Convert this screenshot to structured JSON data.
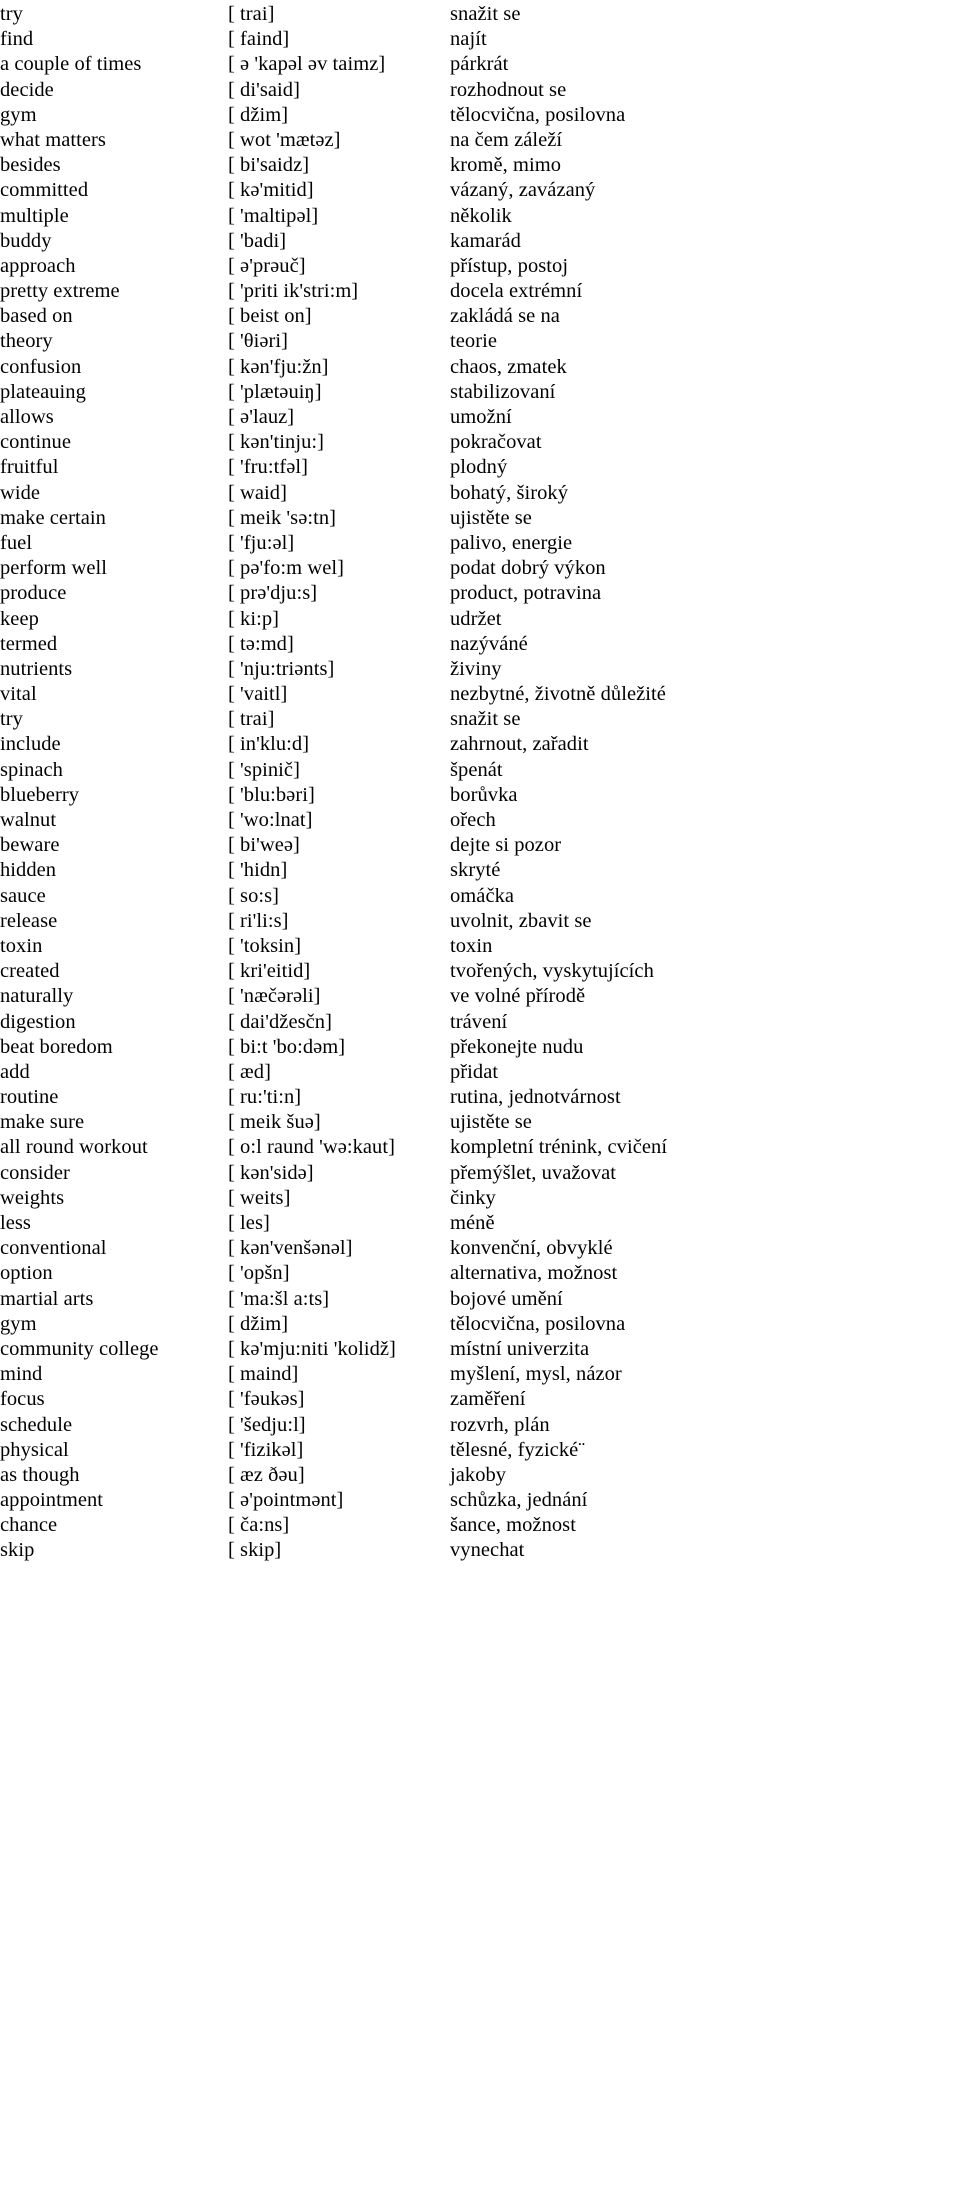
{
  "document": {
    "type": "vocabulary-list",
    "columns": [
      "english",
      "phonetic",
      "czech"
    ],
    "background_color": "#ffffff",
    "text_color": "#000000"
  },
  "rows": [
    {
      "english": "try",
      "phonetic": "[ trai]",
      "czech": "snažit se"
    },
    {
      "english": "find",
      "phonetic": "[ faind]",
      "czech": "najít"
    },
    {
      "english": "a couple of times",
      "phonetic": "[ ə 'kapəl əv taimz]",
      "czech": "párkrát"
    },
    {
      "english": "decide",
      "phonetic": "[ di'said]",
      "czech": "rozhodnout se"
    },
    {
      "english": "gym",
      "phonetic": "[ džim]",
      "czech": "tělocvična, posilovna"
    },
    {
      "english": "what matters",
      "phonetic": "[ wot 'mætəz]",
      "czech": "na čem záleží"
    },
    {
      "english": "besides",
      "phonetic": "[ bi'saidz]",
      "czech": "kromě, mimo"
    },
    {
      "english": "committed",
      "phonetic": "[ kə'mitid]",
      "czech": "vázaný, zavázaný"
    },
    {
      "english": "multiple",
      "phonetic": "[ 'maltipəl]",
      "czech": "několik"
    },
    {
      "english": "buddy",
      "phonetic": "[ 'badi]",
      "czech": "kamarád"
    },
    {
      "english": "approach",
      "phonetic": "[ ə'prəuč]",
      "czech": "přístup, postoj"
    },
    {
      "english": "pretty extreme",
      "phonetic": "[ 'priti ik'stri:m]",
      "czech": "docela extrémní"
    },
    {
      "english": "based on",
      "phonetic": "[ beist on]",
      "czech": "zakládá se na"
    },
    {
      "english": "theory",
      "phonetic": "[ 'θiəri]",
      "czech": "teorie"
    },
    {
      "english": "confusion",
      "phonetic": "[ kən'fju:žn]",
      "czech": "chaos, zmatek"
    },
    {
      "english": "plateauing",
      "phonetic": "[ 'plætəuiŋ]",
      "czech": "stabilizovaní"
    },
    {
      "english": "allows",
      "phonetic": "[ ə'lauz]",
      "czech": "umožní"
    },
    {
      "english": "continue",
      "phonetic": "[ kən'tinju:]",
      "czech": "pokračovat"
    },
    {
      "english": "fruitful",
      "phonetic": "[ 'fru:tfəl]",
      "czech": "plodný"
    },
    {
      "english": "wide",
      "phonetic": "[ waid]",
      "czech": "bohatý, široký"
    },
    {
      "english": "make certain",
      "phonetic": "[ meik 'sə:tn]",
      "czech": "ujistěte se"
    },
    {
      "english": "fuel",
      "phonetic": "[ 'fju:əl]",
      "czech": "palivo, energie"
    },
    {
      "english": "perform well",
      "phonetic": "[ pə'fo:m wel]",
      "czech": "podat dobrý výkon"
    },
    {
      "english": "produce",
      "phonetic": "[ prə'dju:s]",
      "czech": "product, potravina"
    },
    {
      "english": "keep",
      "phonetic": "[ ki:p]",
      "czech": "udržet"
    },
    {
      "english": "termed",
      "phonetic": "[ tə:md]",
      "czech": "nazýváné"
    },
    {
      "english": "nutrients",
      "phonetic": "[ 'nju:triənts]",
      "czech": "živiny"
    },
    {
      "english": "vital",
      "phonetic": "[ 'vaitl]",
      "czech": "nezbytné, životně důležité"
    },
    {
      "english": "try",
      "phonetic": "[ trai]",
      "czech": "snažit se"
    },
    {
      "english": "include",
      "phonetic": "[ in'klu:d]",
      "czech": "zahrnout, zařadit"
    },
    {
      "english": "spinach",
      "phonetic": "[ 'spinič]",
      "czech": "špenát"
    },
    {
      "english": "blueberry",
      "phonetic": "[ 'blu:bəri]",
      "czech": "borůvka"
    },
    {
      "english": "walnut",
      "phonetic": "[ 'wo:lnat]",
      "czech": "ořech"
    },
    {
      "english": "beware",
      "phonetic": "[ bi'weə]",
      "czech": "dejte si pozor"
    },
    {
      "english": "hidden",
      "phonetic": "[ 'hidn]",
      "czech": "skryté"
    },
    {
      "english": "sauce",
      "phonetic": "[ so:s]",
      "czech": "omáčka"
    },
    {
      "english": "release",
      "phonetic": "[ ri'li:s]",
      "czech": "uvolnit, zbavit se"
    },
    {
      "english": "toxin",
      "phonetic": "[ 'toksin]",
      "czech": "toxin"
    },
    {
      "english": "created",
      "phonetic": "[ kri'eitid]",
      "czech": "tvořených, vyskytujících"
    },
    {
      "english": "naturally",
      "phonetic": "[ 'næčərəli]",
      "czech": "ve volné přírodě"
    },
    {
      "english": "digestion",
      "phonetic": "[ dai'džesčn]",
      "czech": "trávení"
    },
    {
      "english": "beat boredom",
      "phonetic": "[ bi:t 'bo:dəm]",
      "czech": "překonejte nudu"
    },
    {
      "english": "add",
      "phonetic": "[ æd]",
      "czech": "přidat"
    },
    {
      "english": "routine",
      "phonetic": "[ ru:'ti:n]",
      "czech": "rutina, jednotvárnost"
    },
    {
      "english": "make sure",
      "phonetic": "[ meik šuə]",
      "czech": "ujistěte se"
    },
    {
      "english": "all round workout",
      "phonetic": "[ o:l raund 'wə:kaut]",
      "czech": "kompletní trénink, cvičení"
    },
    {
      "english": "consider",
      "phonetic": "[ kən'sidə]",
      "czech": "přemýšlet, uvažovat"
    },
    {
      "english": "weights",
      "phonetic": "[ weits]",
      "czech": "činky"
    },
    {
      "english": "less",
      "phonetic": "[ les]",
      "czech": "méně"
    },
    {
      "english": "conventional",
      "phonetic": "[ kən'venšənəl]",
      "czech": "konvenční, obvyklé"
    },
    {
      "english": "option",
      "phonetic": "[ 'opšn]",
      "czech": "alternativa, možnost"
    },
    {
      "english": "martial arts",
      "phonetic": "[ 'ma:šl a:ts]",
      "czech": "bojové umění"
    },
    {
      "english": "gym",
      "phonetic": "[ džim]",
      "czech": "tělocvična, posilovna"
    },
    {
      "english": "community college",
      "phonetic": "[ kə'mju:niti 'kolidž]",
      "czech": "místní univerzita"
    },
    {
      "english": "mind",
      "phonetic": "[ maind]",
      "czech": "myšlení, mysl, názor"
    },
    {
      "english": "focus",
      "phonetic": "[ 'fəukəs]",
      "czech": "zaměření"
    },
    {
      "english": "schedule",
      "phonetic": "[ 'šedju:l]",
      "czech": "rozvrh, plán"
    },
    {
      "english": "physical",
      "phonetic": "[ 'fizikəl]",
      "czech": "tělesné, fyzické¨"
    },
    {
      "english": "as though",
      "phonetic": "[ æz ðəu]",
      "czech": "jakoby"
    },
    {
      "english": "appointment",
      "phonetic": "[ ə'pointmənt]",
      "czech": "schůzka, jednání"
    },
    {
      "english": "chance",
      "phonetic": "[ ča:ns]",
      "czech": "šance, možnost"
    },
    {
      "english": "skip",
      "phonetic": "[ skip]",
      "czech": "vynechat"
    }
  ]
}
